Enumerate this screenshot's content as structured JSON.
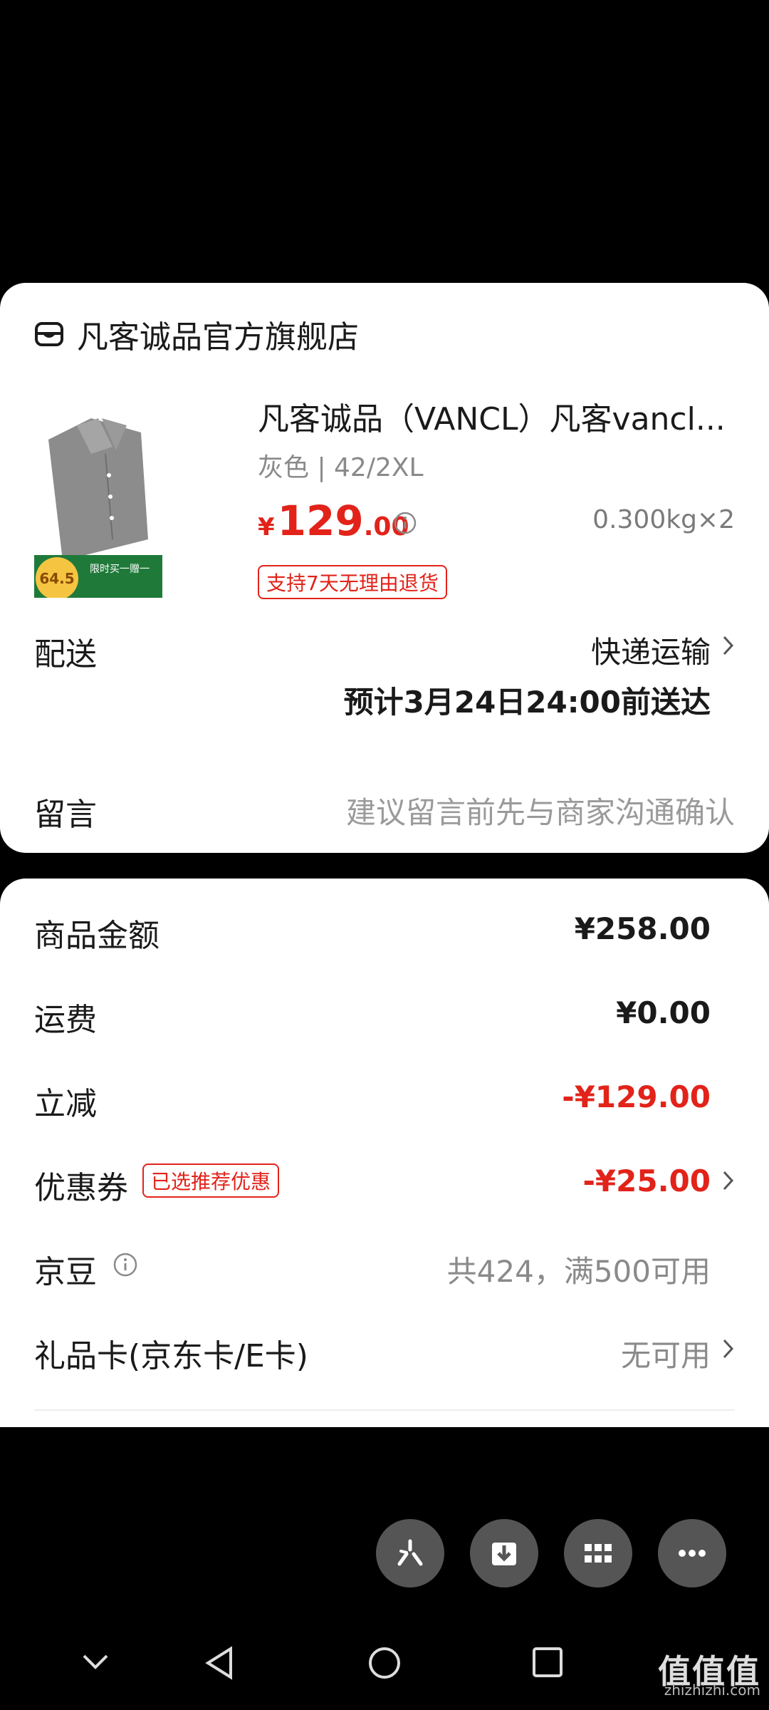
{
  "store": {
    "name": "凡客诚品官方旗舰店",
    "icon": "store-icon"
  },
  "product": {
    "title": "凡客诚品（VANCL）凡客vancl...",
    "spec": "灰色 | 42/2XL",
    "price_symbol": "¥",
    "price_int": "129",
    "price_dec": ".00",
    "weight": "0.300kg×2",
    "return_badge": "支持7天无理由退货",
    "image_badge_price": "64.5",
    "image_badge_text": "限时买一赠一"
  },
  "delivery": {
    "label": "配送",
    "method": "快递运输",
    "eta": "预计3月24日24:00前送达"
  },
  "message": {
    "label": "留言",
    "placeholder": "建议留言前先与商家沟通确认"
  },
  "summary": {
    "goods_amount": {
      "label": "商品金额",
      "value": "¥258.00"
    },
    "shipping": {
      "label": "运费",
      "value": "¥0.00"
    },
    "discount": {
      "label": "立减",
      "value": "-¥129.00"
    },
    "coupon": {
      "label": "优惠券",
      "badge": "已选推荐优惠",
      "value": "-¥25.00"
    },
    "jd_beans": {
      "label": "京豆",
      "value": "共424，满500可用"
    },
    "gift_card": {
      "label": "礼品卡(京东卡/E卡)",
      "value": "无可用"
    }
  },
  "watermark": {
    "big": "值值值",
    "small": "zhizhizhi.com"
  },
  "colors": {
    "accent": "#e2231a",
    "muted": "#8a8a8a"
  }
}
